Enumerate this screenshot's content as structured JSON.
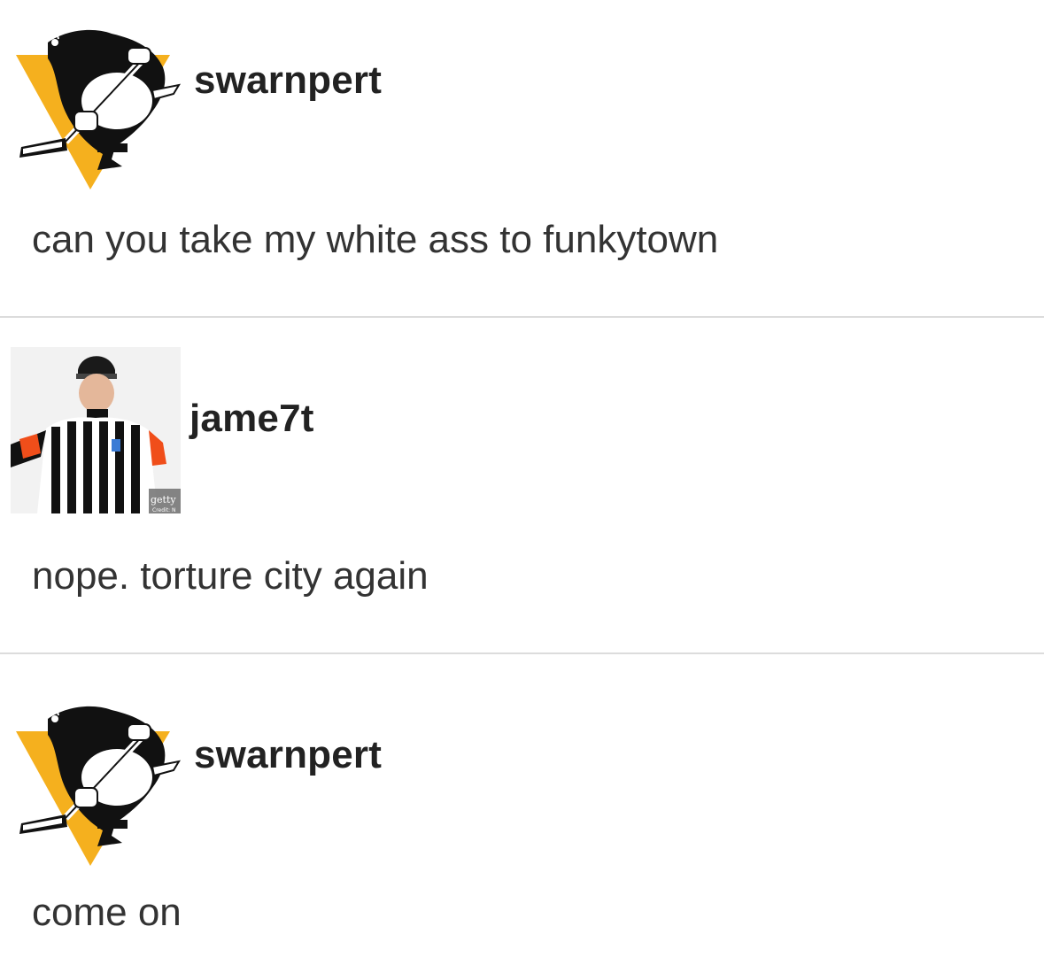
{
  "posts": [
    {
      "username": "swarnpert",
      "avatar_icon": "pittsburgh-penguins-logo",
      "message": "can you take my white ass to funkytown"
    },
    {
      "username": "jame7t",
      "avatar_icon": "hockey-referee-photo",
      "avatar_watermark": "getty",
      "avatar_credit": "Credit: N",
      "message": "nope. torture city again"
    },
    {
      "username": "swarnpert",
      "avatar_icon": "pittsburgh-penguins-logo",
      "message": "come on"
    }
  ],
  "colors": {
    "penguins_gold": "#F5B01E",
    "penguins_black": "#111111",
    "referee_orange": "#F04E1A",
    "divider": "#DCDCDC"
  }
}
